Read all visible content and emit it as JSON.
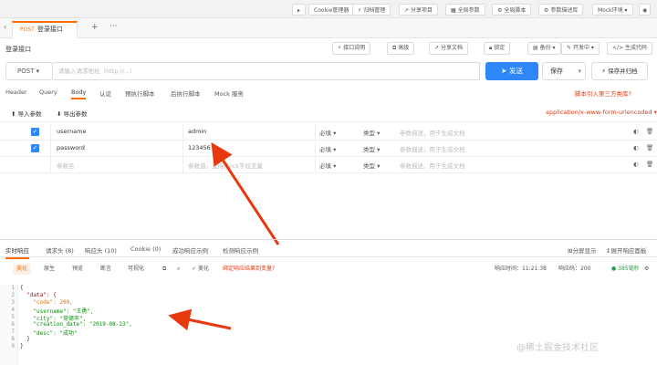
{
  "topbar": {
    "items": [
      "Cookie管理器",
      "归档管理",
      "分享项目",
      "全局参数",
      "全局脚本",
      "参数描述库",
      "Mock环境"
    ]
  },
  "tabs": [
    {
      "method": "POST",
      "label": "登录接口"
    }
  ],
  "title": "登录接口",
  "title_actions": [
    "接口说明",
    "高级",
    "分享文档",
    "锁定",
    "备份",
    "开发中",
    "生成代码"
  ],
  "request": {
    "method": "POST",
    "url_placeholder": "请输入请求地址（http://...）",
    "send": "发送",
    "save": "保存",
    "save_gen": "保存并归档"
  },
  "subtabs": [
    "Header",
    "Query",
    "Body",
    "认证",
    "预执行脚本",
    "后执行脚本",
    "Mock 服务"
  ],
  "subtab_active": 2,
  "script_link": "脚本引入第三方类库?",
  "params_toolbar": {
    "import": "导入参数",
    "export": "导出参数",
    "content_type": "application/x-www-form-urlencoded"
  },
  "params": [
    {
      "checked": true,
      "name": "username",
      "value": "admin",
      "required": "必填",
      "type": "类型",
      "desc": "参数描述，用于生成文档"
    },
    {
      "checked": true,
      "name": "password",
      "value": "123456",
      "required": "必填",
      "type": "类型",
      "desc": "参数描述，用于生成文档"
    },
    {
      "checked": false,
      "name": "参数名",
      "value": "参数值，支持Mock字段变量",
      "required": "必填",
      "type": "类型",
      "desc": "参数描述，用于生成文档"
    }
  ],
  "response": {
    "tabs": [
      "实时响应",
      "请求头 (8)",
      "响应头 (10)",
      "Cookie (0)",
      "成功响应示例",
      "检测响应示例"
    ],
    "active": 0,
    "split": "分屏显示",
    "expand": "展开响应面板",
    "views": [
      "美化",
      "原生",
      "预览",
      "断言",
      "可视化"
    ],
    "bind_text": "绑定响应结果到变量?",
    "beautify": "美化",
    "time_label": "响应时间：11:21:38",
    "status_label": "响应码：200",
    "duration": "385毫秒",
    "code_lines": [
      {
        "n": "1",
        "t": "{"
      },
      {
        "n": "2",
        "t": "  \"data\": {"
      },
      {
        "n": "3",
        "t": "    \"code\": 200,"
      },
      {
        "n": "4",
        "t": "    \"username\": \"王勇\","
      },
      {
        "n": "5",
        "t": "    \"city\": \"常德市\","
      },
      {
        "n": "6",
        "t": "    \"creation_date\": \"2019-08-23\","
      },
      {
        "n": "7",
        "t": "    \"desc\": \"成功\""
      },
      {
        "n": "8",
        "t": "  }"
      },
      {
        "n": "9",
        "t": "}"
      }
    ]
  },
  "watermark": "@稀土掘金技术社区",
  "colors": {
    "accent": "#ff6b00",
    "primary": "#2f86f6",
    "arrow": "#e8380d"
  }
}
